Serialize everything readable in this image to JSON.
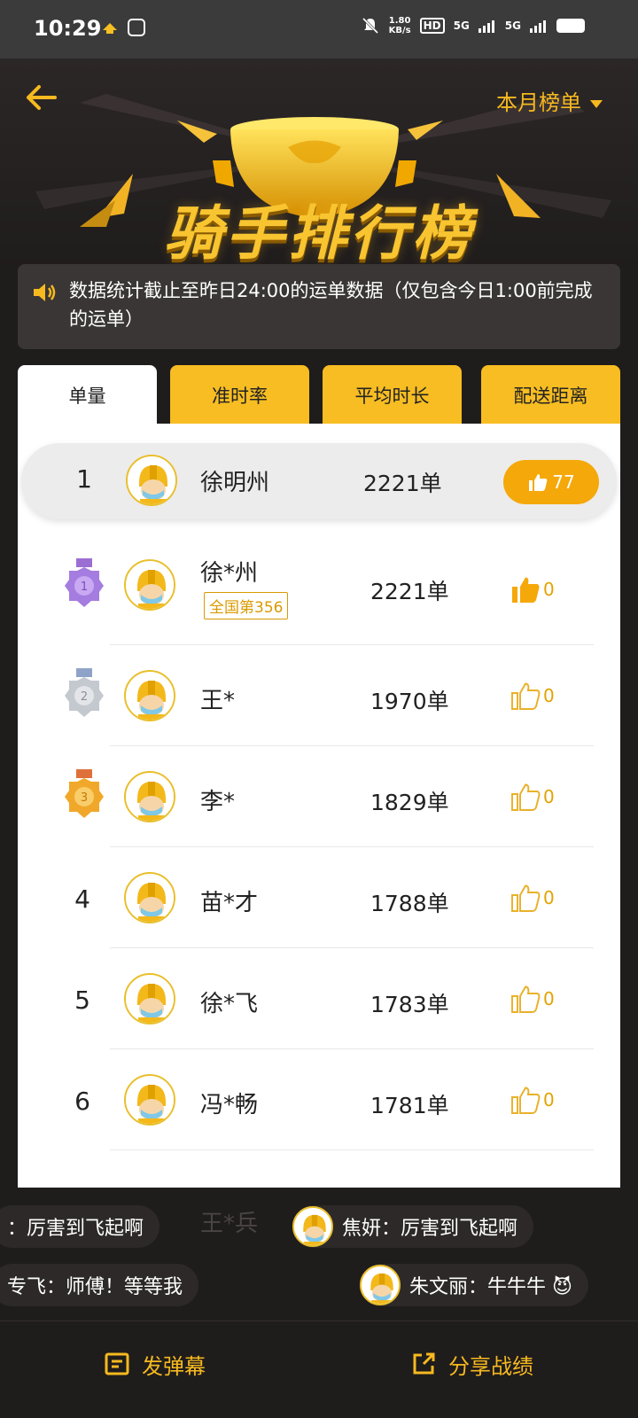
{
  "status_bar": {
    "time": "10:29",
    "net_speed": "1.80",
    "net_unit": "KB/s",
    "hd": "HD",
    "sig1": "5G",
    "sig2": "5G"
  },
  "header": {
    "period": "本月榜单",
    "title": "骑手排行榜"
  },
  "notice": {
    "text": "数据统计截止至昨日24:00的运单数据（仅包含今日1:00前完成的运单）"
  },
  "tabs": [
    {
      "label": "单量"
    },
    {
      "label": "准时率"
    },
    {
      "label": "平均时长"
    },
    {
      "label": "配送距离"
    }
  ],
  "me": {
    "rank": "1",
    "name": "徐明州",
    "orders": "2221单",
    "likes": "77"
  },
  "rows": [
    {
      "rank": "1",
      "name": "徐*州",
      "badge": "全国第356",
      "orders": "2221单",
      "likes": "0",
      "medal": "purple-medal",
      "liked": true
    },
    {
      "rank": "2",
      "name": "王*",
      "orders": "1970单",
      "likes": "0",
      "medal": "silver-medal",
      "liked": false
    },
    {
      "rank": "3",
      "name": "李*",
      "orders": "1829单",
      "likes": "0",
      "medal": "bronze-medal",
      "liked": false
    },
    {
      "rank": "4",
      "name": "苗*才",
      "orders": "1788单",
      "likes": "0",
      "liked": false
    },
    {
      "rank": "5",
      "name": "徐*飞",
      "orders": "1783单",
      "likes": "0",
      "liked": false
    },
    {
      "rank": "6",
      "name": "冯*畅",
      "orders": "1781单",
      "likes": "0",
      "liked": false
    }
  ],
  "faded_row_name": "王*兵",
  "danmaku": [
    {
      "text": "：厉害到飞起啊"
    },
    {
      "text": "焦妍：厉害到飞起啊"
    },
    {
      "text": "专飞：师傅！等等我"
    },
    {
      "text": "朱文丽：牛牛牛 😈"
    }
  ],
  "bottom": {
    "send_danmaku": "发弹幕",
    "share": "分享战绩"
  },
  "colors": {
    "accent": "#f6b91f",
    "background": "#1f1c1c",
    "tab_inactive": "#f7bd22",
    "like_active": "#f5a80a"
  }
}
